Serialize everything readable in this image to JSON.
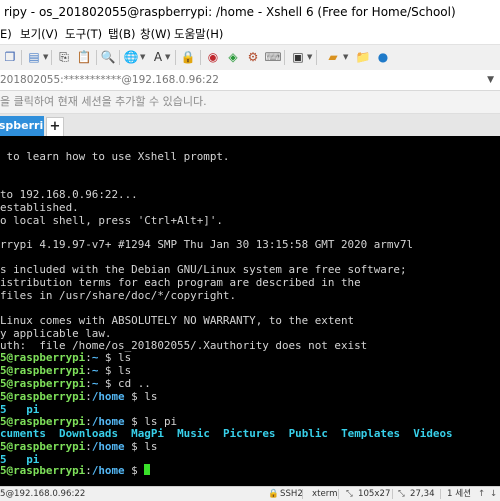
{
  "window": {
    "title": "ripy - os_201802055@raspberrypi: /home - Xshell 6 (Free for Home/School)"
  },
  "menu": {
    "items": [
      "E)",
      "보기(V)",
      "도구(T)",
      "탭(B)",
      "창(W)",
      "도움말(H)"
    ]
  },
  "address": {
    "text": "201802055:***********@192.168.0.96:22"
  },
  "infobar": {
    "text": "을 클릭하여 현재 세션을 추가할 수 있습니다."
  },
  "tabs": {
    "active_label": "raspberripy",
    "add_label": "+"
  },
  "terminal": {
    "lines": {
      "l1": " to learn how to use Xshell prompt.",
      "l2": "to 192.168.0.96:22...",
      "l3": "established.",
      "l4": "o local shell, press 'Ctrl+Alt+]'.",
      "l5": "rrypi 4.19.97-v7+ #1294 SMP Thu Jan 30 13:15:58 GMT 2020 armv7l",
      "l6": "s included with the Debian GNU/Linux system are free software;",
      "l7": "istribution terms for each program are described in the",
      "l8": "files in /usr/share/doc/*/copyright.",
      "l9": "Linux comes with ABSOLUTELY NO WARRANTY, to the extent",
      "l10": "y applicable law.",
      "l11": "uth:  file /home/os_201802055/.Xauthority does not exist"
    },
    "prompt_user": "5@raspberrypi",
    "prompt_tilde_dir": "~",
    "prompt_home_dir": "/home",
    "cmd_ls": "ls",
    "cmd_cd": "cd ..",
    "cmd_ls_pi": "ls pi",
    "out_home": "5   pi",
    "out_pi_first": "cuments",
    "out_pi_rest": [
      "Downloads",
      "MagPi",
      "Music",
      "Pictures",
      "Public",
      "Templates",
      "Videos"
    ]
  },
  "status": {
    "connection": "5@192.168.0.96:22",
    "protocol": "SSH2",
    "terminal_type": "xterm",
    "size": "105x27",
    "cursor_pos": "27,34",
    "sessions": "1 세션"
  }
}
